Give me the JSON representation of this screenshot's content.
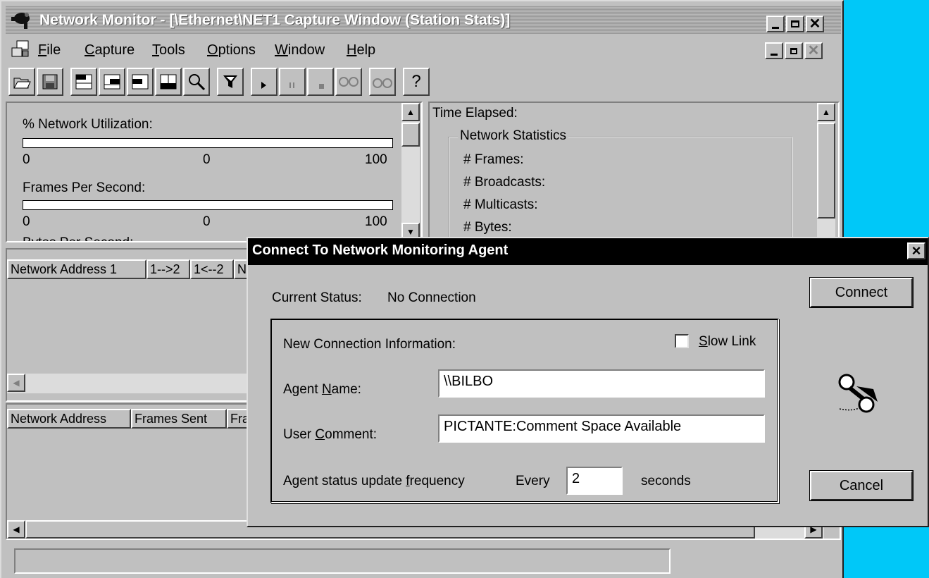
{
  "app": {
    "title": "Network Monitor - [\\Ethernet\\NET1 Capture Window (Station Stats)]",
    "menu": [
      {
        "pre": "",
        "key": "F",
        "post": "ile"
      },
      {
        "pre": "",
        "key": "C",
        "post": "apture"
      },
      {
        "pre": "",
        "key": "T",
        "post": "ools"
      },
      {
        "pre": "",
        "key": "O",
        "post": "ptions"
      },
      {
        "pre": "",
        "key": "W",
        "post": "indow"
      },
      {
        "pre": "",
        "key": "H",
        "post": "elp"
      }
    ],
    "toolbar_help_label": "?"
  },
  "gauges": {
    "utilization": {
      "label": "% Network Utilization:",
      "min": "0",
      "value": "0",
      "max": "100"
    },
    "frames": {
      "label": "Frames Per Second:",
      "min": "0",
      "value": "0",
      "max": "100"
    },
    "bytes_label_partial": "Bytes Per Second:"
  },
  "stats": {
    "time_elapsed_label": "Time Elapsed:",
    "group_title": "Network Statistics",
    "frames_label": "# Frames:",
    "broadcasts_label": "# Broadcasts:",
    "multicasts_label": "# Multicasts:",
    "bytes_label": "# Bytes:"
  },
  "session_table": {
    "headers": [
      "Network Address 1",
      "1-->2",
      "1<--2",
      "Ne"
    ]
  },
  "station_table": {
    "headers": [
      "Network Address",
      "Frames Sent",
      "Fra"
    ]
  },
  "dialog": {
    "title": "Connect To Network Monitoring Agent",
    "close_glyph": "×",
    "current_status_label": "Current Status:",
    "current_status_value": "No Connection",
    "group_label": "New Connection Information:",
    "slow_link": {
      "pre": "",
      "key": "S",
      "post": "low Link",
      "checked": false
    },
    "agent_name": {
      "pre": "Agent ",
      "key": "N",
      "post": "ame:",
      "value": "\\\\BILBO"
    },
    "user_comment": {
      "pre": "User ",
      "key": "C",
      "post": "omment:",
      "value": "PICTANTE:Comment Space Available"
    },
    "update": {
      "pre": "Agent status update ",
      "key": "f",
      "post": "requency",
      "every": "Every",
      "value": "2",
      "unit": "seconds"
    },
    "connect_label": "Connect",
    "cancel_label": "Cancel"
  },
  "colors": {
    "desktop": "#00c8f8",
    "window_face": "#c0c0c0",
    "dialog_title_bg": "#000000",
    "title_bg_inactive": "#9a9a9a"
  }
}
